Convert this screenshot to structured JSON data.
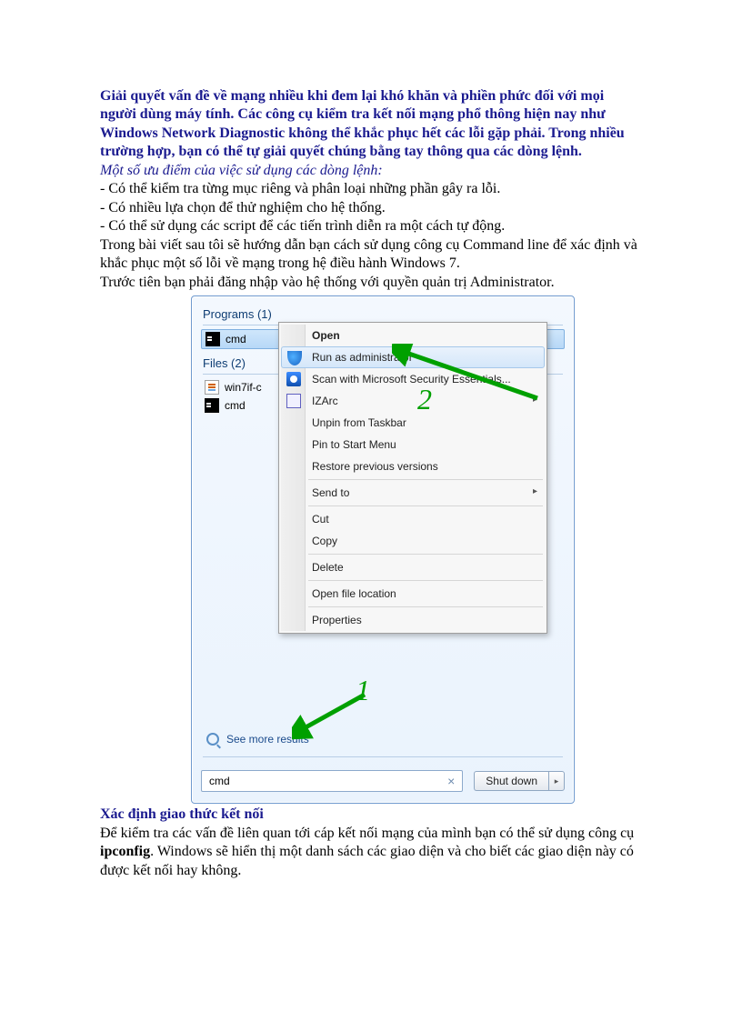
{
  "intro": "Giải quyết vấn đề về mạng nhiều khi đem lại khó khăn và phiền phức đối với mọi người dùng máy tính. Các công cụ kiểm tra kết nối mạng phổ thông hiện nay như Windows Network Diagnostic không thể khắc phục hết các lỗi gặp phải. Trong nhiều trường hợp, bạn có thể tự giải quyết chúng bằng tay thông qua các dòng lệnh.",
  "subhead": "Một số ưu điểm của việc sử dụng các dòng lệnh:",
  "bullets": [
    "- Có thể kiểm tra từng mục riêng và phân loại những phần gây ra lỗi.",
    "- Có nhiều lựa chọn để thử nghiệm cho hệ thống.",
    "- Có thể sử dụng các script để các tiến trình diễn ra một cách tự động."
  ],
  "para2": "Trong bài viết sau tôi sẽ hướng dẫn bạn cách sử dụng công cụ Command line để xác định và khắc phục một số lỗi về mạng trong hệ điều hành Windows 7.",
  "para3": "Trước tiên bạn phải đăng nhập vào hệ thống với quyền quản trị Administrator.",
  "section_title": "Xác định giao thức kết nối",
  "para4_pre": "Để kiểm tra các vấn đề liên quan tới cáp kết nối mạng của mình bạn có thể sử dụng công cụ ",
  "para4_bold": "ipconfig",
  "para4_post": ". Windows sẽ hiển thị một danh sách các giao diện và cho biết các giao diện này có được kết nối hay không.",
  "shot": {
    "programs_label": "Programs (1)",
    "programs_item": "cmd",
    "files_label": "Files (2)",
    "files_items": [
      "win7if-c",
      "cmd"
    ],
    "see_more": "See more results",
    "search_value": "cmd",
    "shutdown_label": "Shut down",
    "annot1": "1",
    "annot2": "2",
    "menu": {
      "open": "Open",
      "runas": "Run as administrator",
      "scan": "Scan with Microsoft Security Essentials...",
      "izarc": "IZArc",
      "unpin": "Unpin from Taskbar",
      "pin": "Pin to Start Menu",
      "restore": "Restore previous versions",
      "sendto": "Send to",
      "cut": "Cut",
      "copy": "Copy",
      "delete": "Delete",
      "openloc": "Open file location",
      "props": "Properties"
    }
  }
}
